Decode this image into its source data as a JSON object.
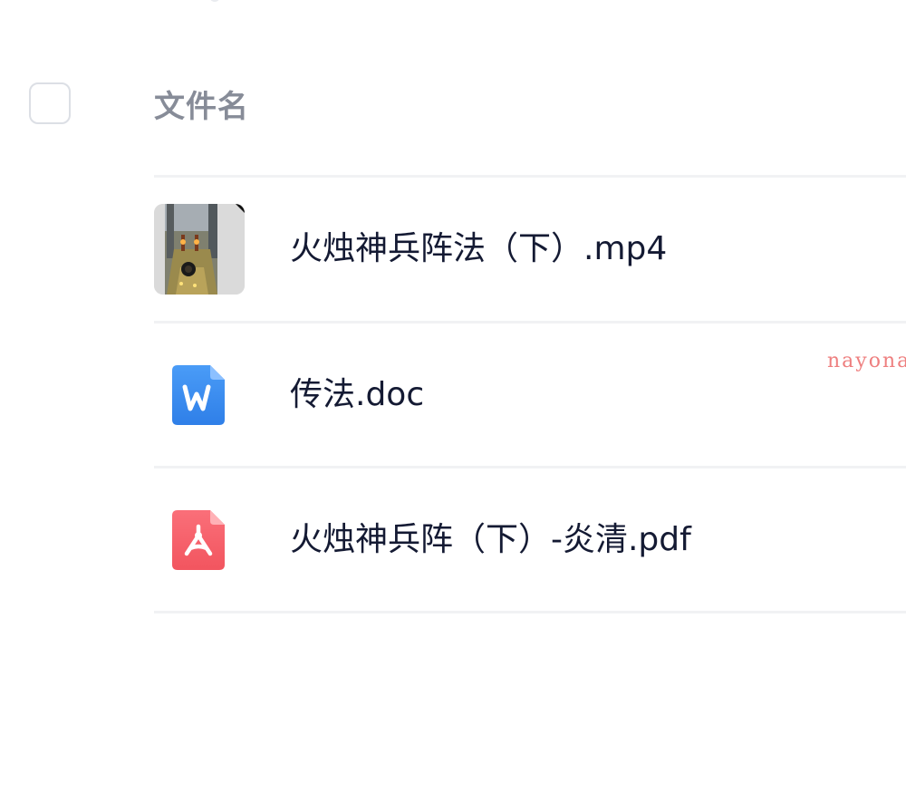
{
  "header": {
    "column_label": "文件名"
  },
  "files": [
    {
      "name": "火烛神兵阵法（下）.mp4",
      "type": "video",
      "icon": "video-thumbnail"
    },
    {
      "name": "传法.doc",
      "type": "word",
      "icon": "word-doc-icon",
      "accent": "#3b8cf0"
    },
    {
      "name": "火烛神兵阵（下）-炎清.pdf",
      "type": "pdf",
      "icon": "pdf-file-icon",
      "accent": "#f5616e"
    }
  ],
  "watermark": {
    "text": "nayona"
  }
}
